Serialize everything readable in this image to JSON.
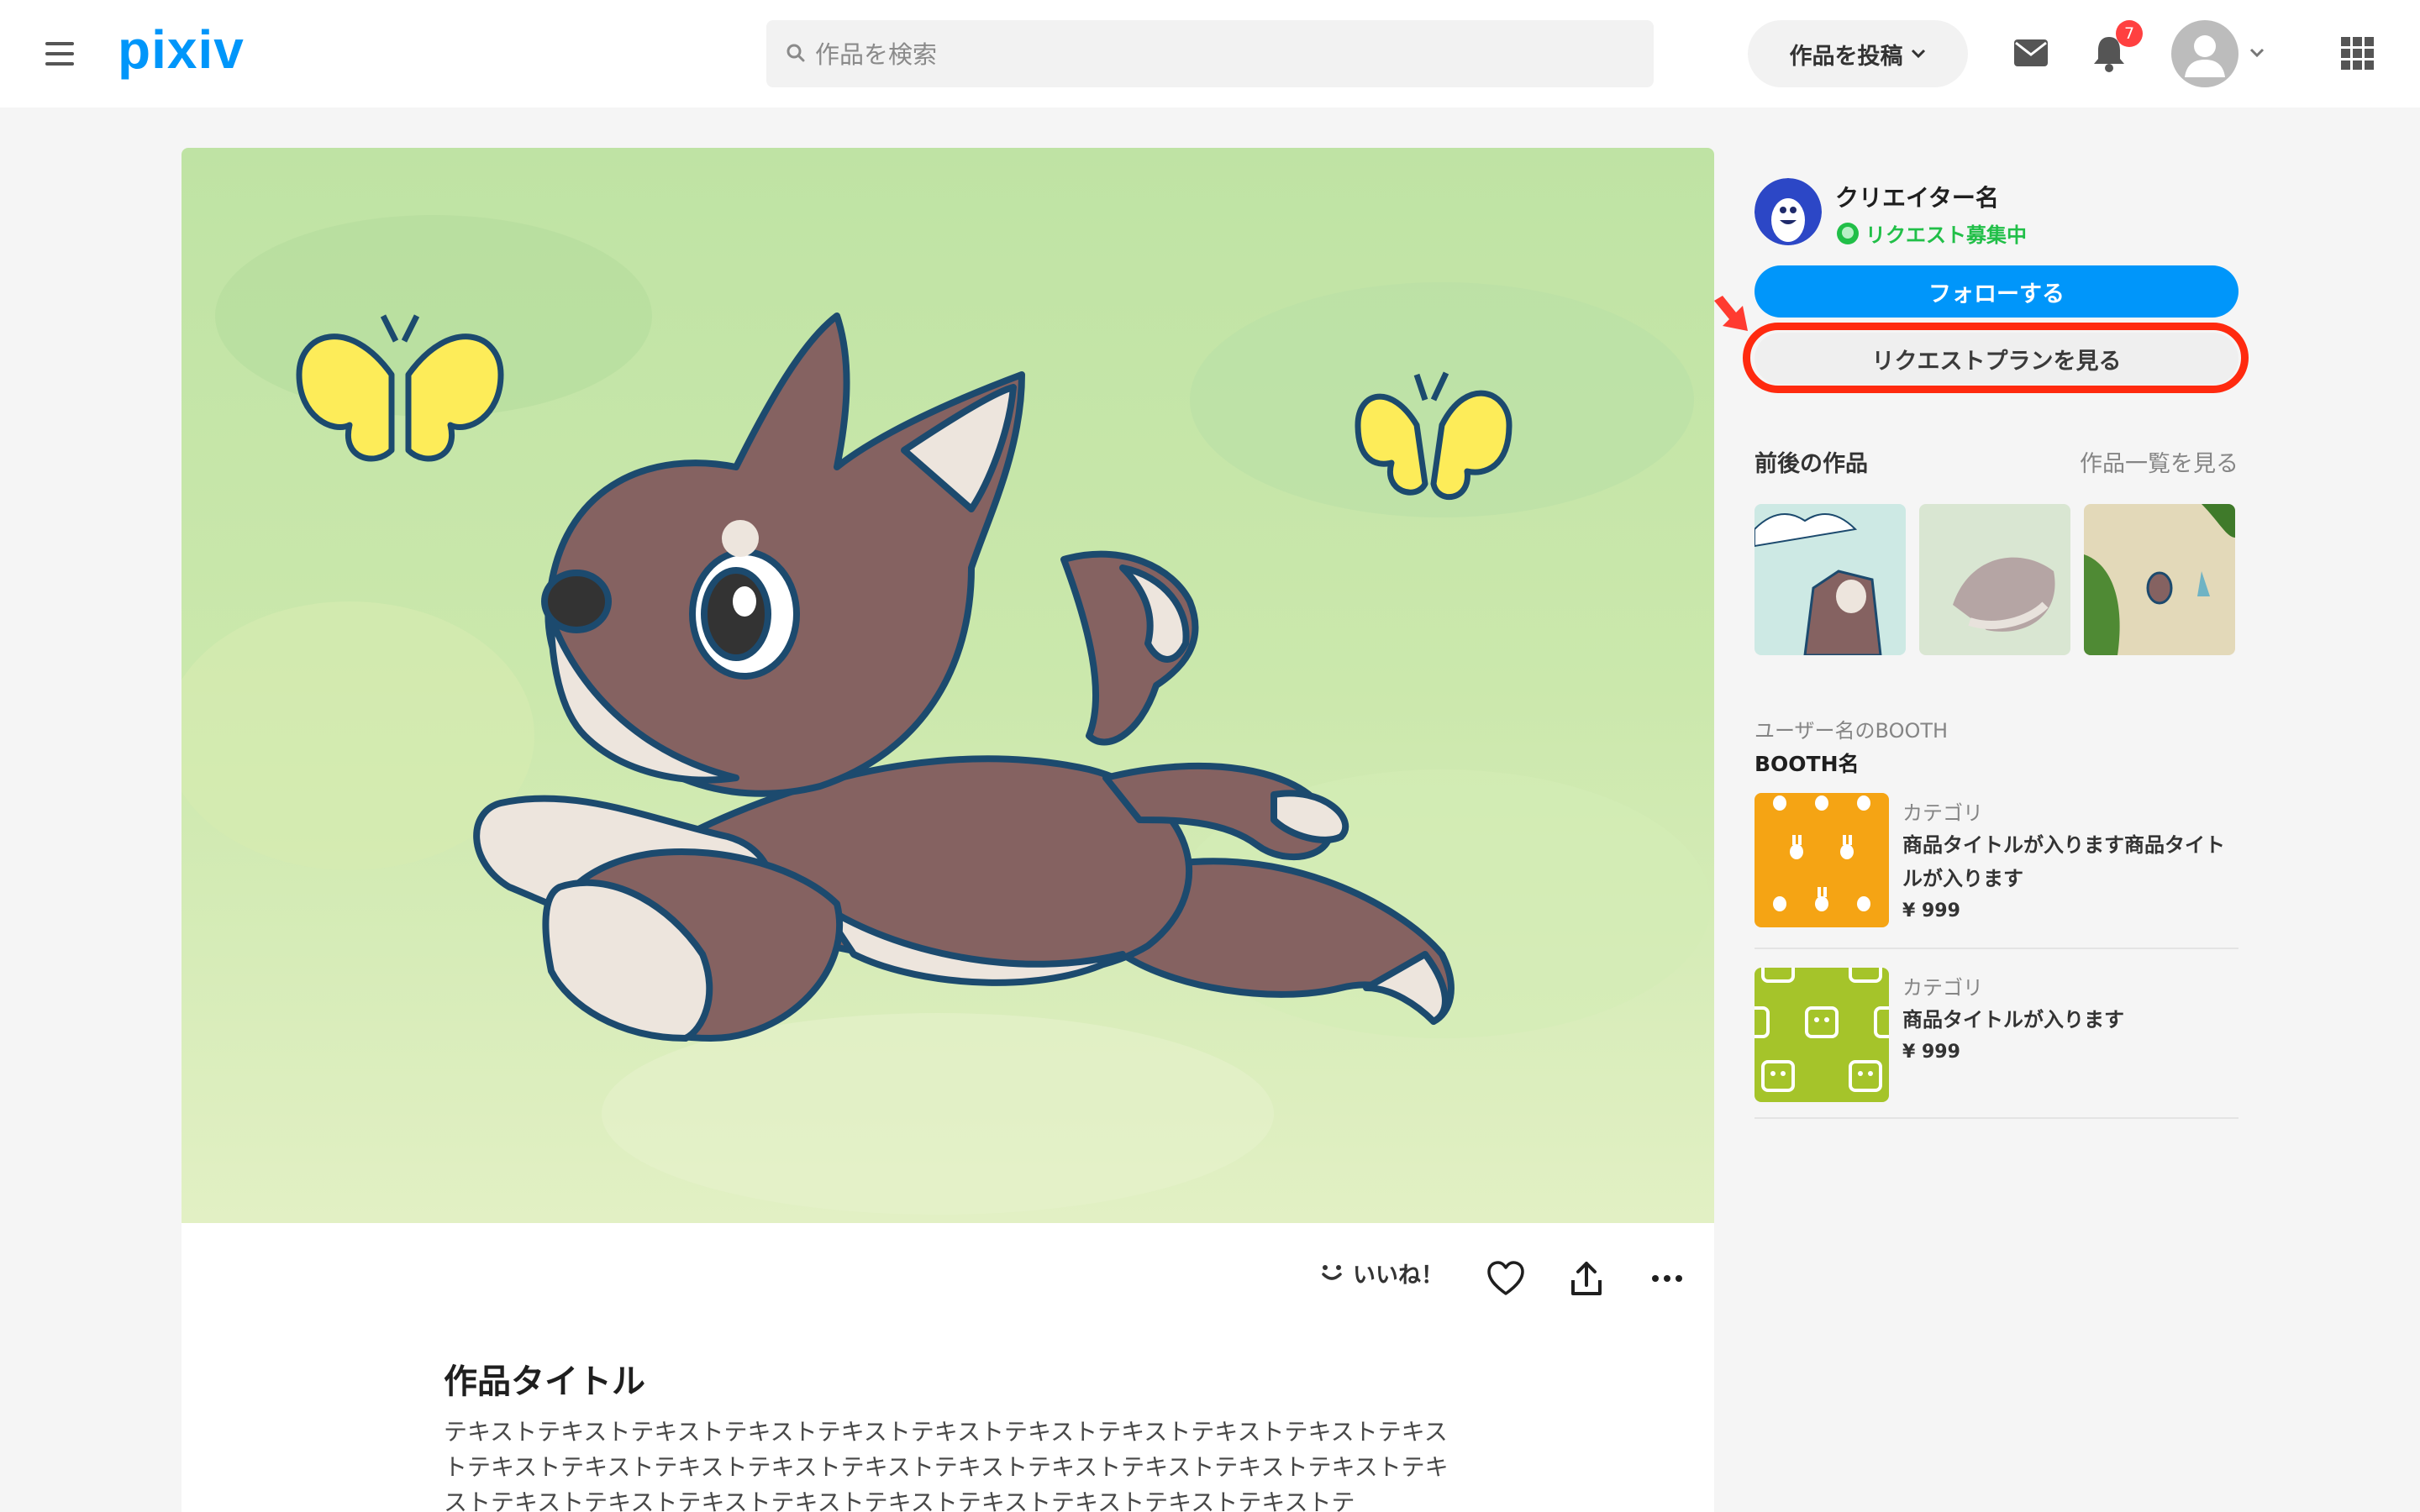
{
  "header": {
    "logo": "pixiv",
    "search_placeholder": "作品を検索",
    "post_label": "作品を投稿",
    "notification_count": "7"
  },
  "artwork": {
    "title": "作品タイトル",
    "description": "テキストテキストテキストテキストテキストテキストテキストテキストテキストテキストテキストテキストテキストテキストテキストテキストテキストテキストテキストテキストテキストテキストテキストテキストテキストテキストテキストテキストテキストテキストテキストテ",
    "like_label": "いいね！"
  },
  "creator": {
    "name": "クリエイター名",
    "request_status": "リクエスト募集中",
    "follow_label": "フォローする",
    "request_plan_label": "リクエストプランを見る"
  },
  "related": {
    "heading": "前後の作品",
    "see_all": "作品一覧を見る"
  },
  "booth": {
    "user_label": "ユーザー名のBOOTH",
    "shop_name": "BOOTH名",
    "products": [
      {
        "category": "カテゴリ",
        "title": "商品タイトルが入ります商品タイトルが入ります",
        "price": "¥ 999"
      },
      {
        "category": "カテゴリ",
        "title": "商品タイトルが入ります",
        "price": "¥ 999"
      }
    ]
  },
  "colors": {
    "accent": "#0096fa",
    "request_green": "#21bf48",
    "highlight_red": "#ff2a0f"
  }
}
